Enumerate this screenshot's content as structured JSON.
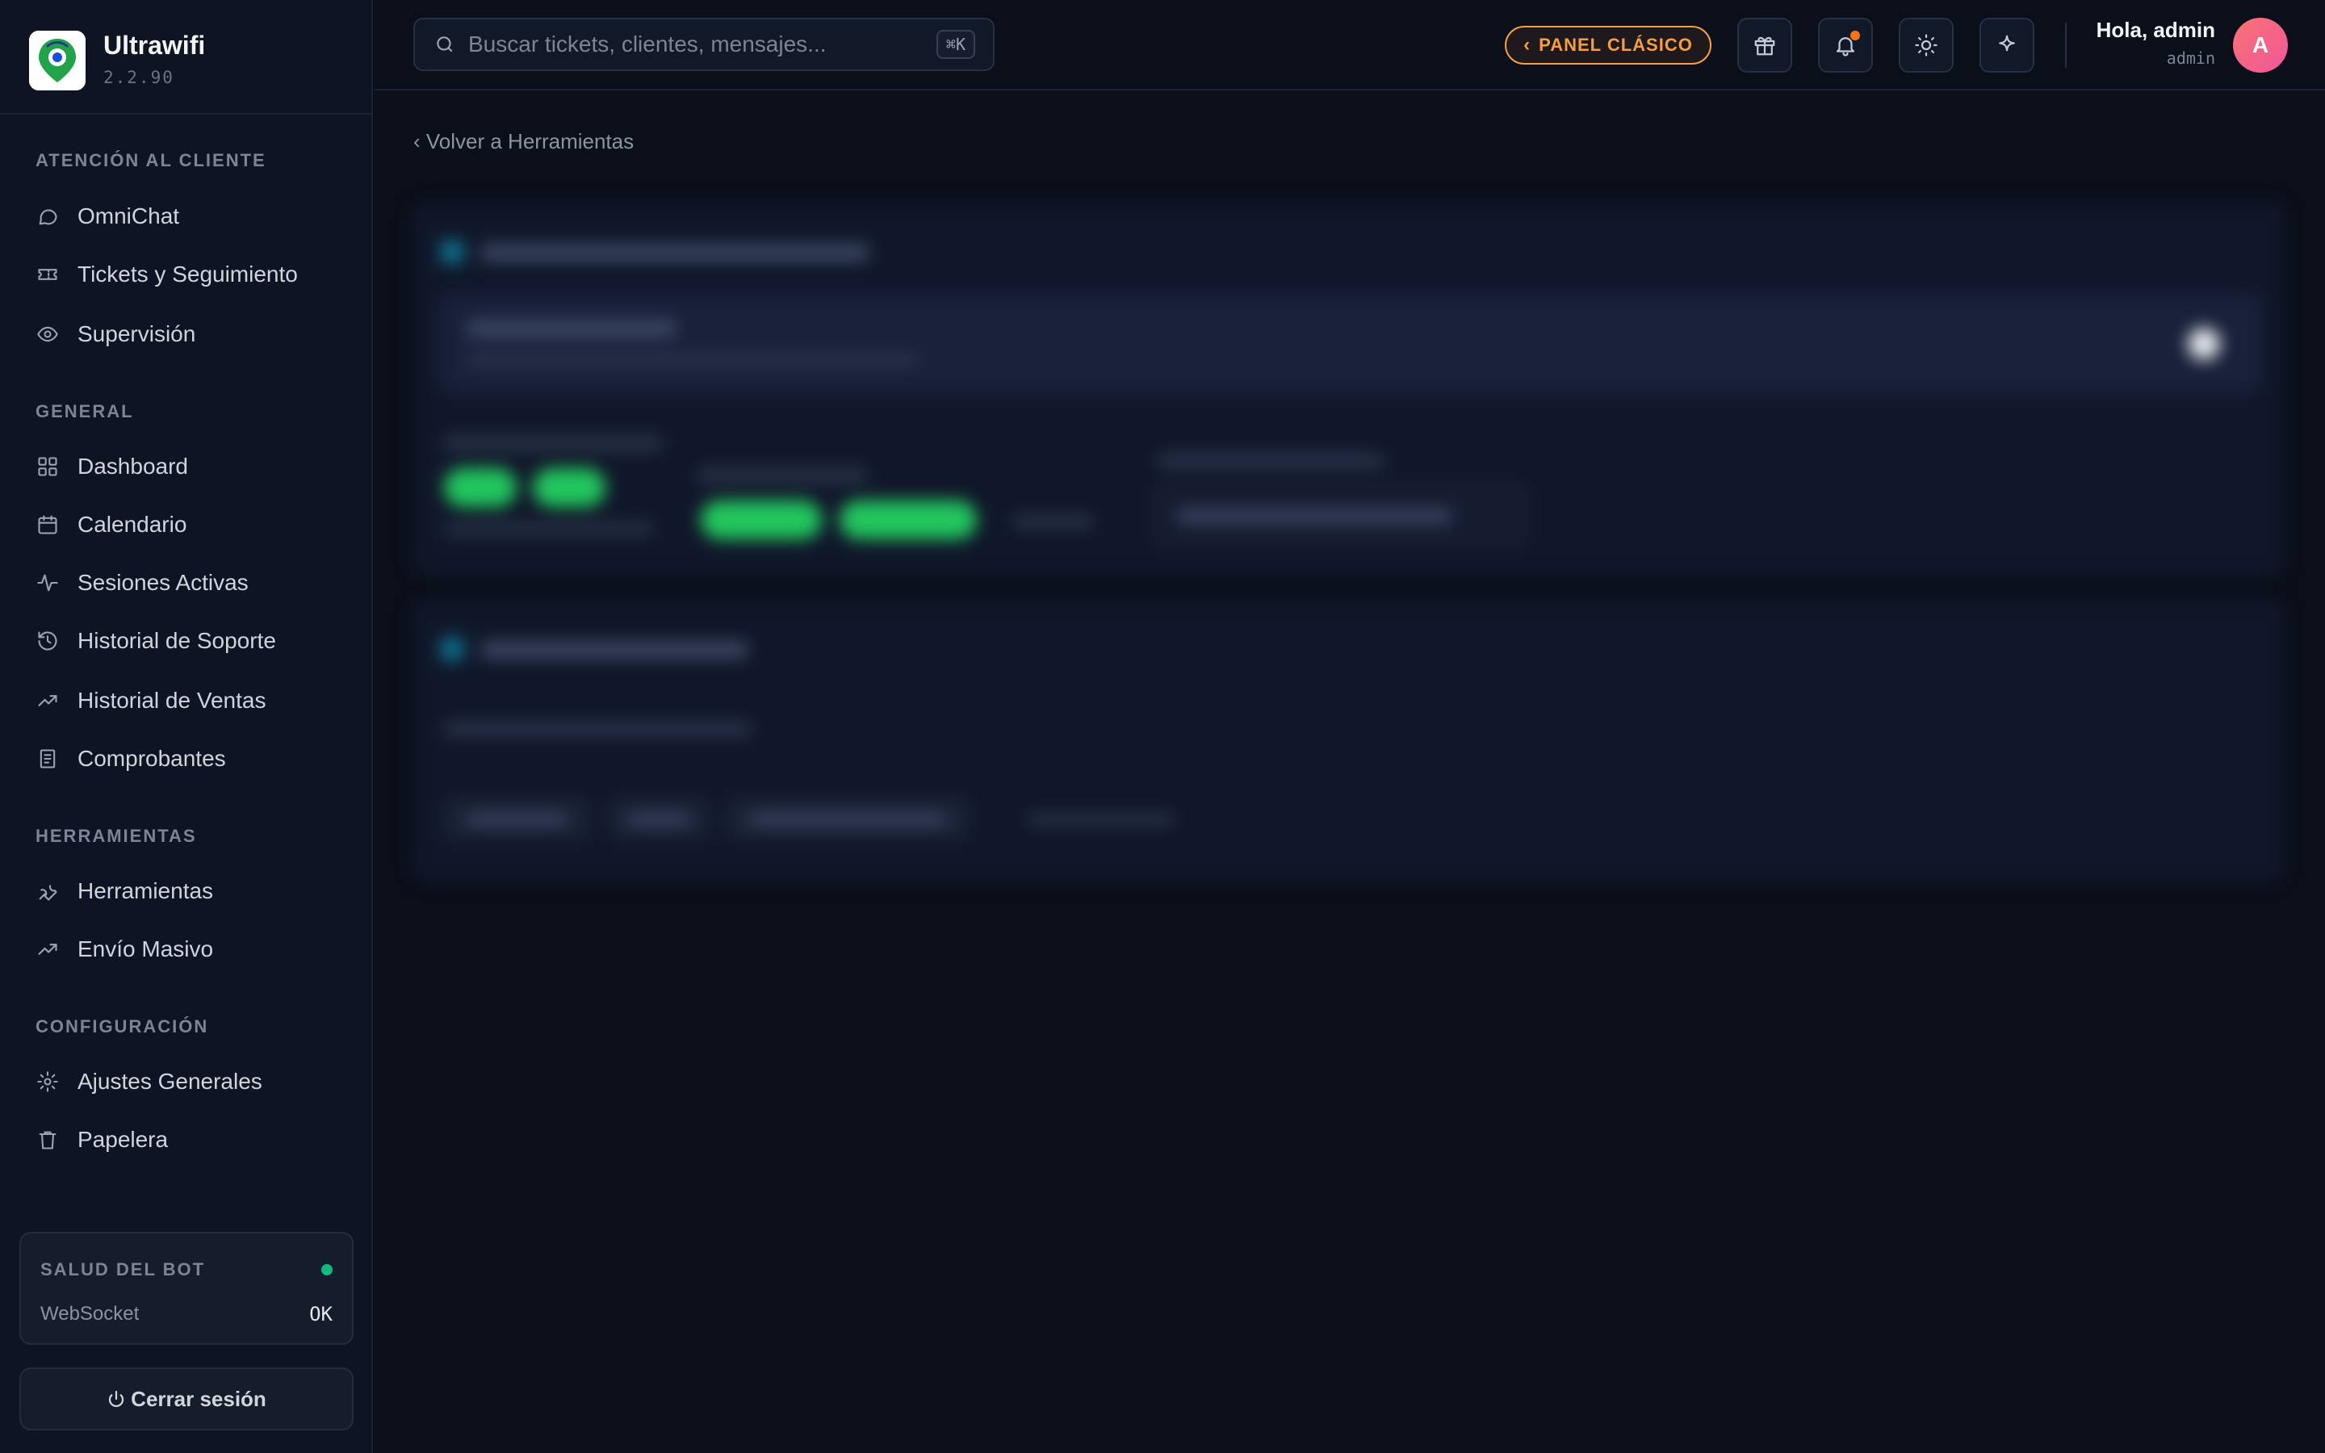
{
  "brand": {
    "name": "Ultrawifi",
    "version": "2.2.90"
  },
  "sidebar": {
    "sections": [
      {
        "label": "ATENCIÓN AL CLIENTE",
        "items": [
          {
            "label": "OmniChat",
            "icon": "chat-bubble-icon"
          },
          {
            "label": "Tickets y Seguimiento",
            "icon": "ticket-icon"
          },
          {
            "label": "Supervisión",
            "icon": "eye-icon"
          }
        ]
      },
      {
        "label": "GENERAL",
        "items": [
          {
            "label": "Dashboard",
            "icon": "grid-icon"
          },
          {
            "label": "Calendario",
            "icon": "calendar-icon"
          },
          {
            "label": "Sesiones Activas",
            "icon": "activity-icon"
          },
          {
            "label": "Historial de Soporte",
            "icon": "history-icon"
          },
          {
            "label": "Historial de Ventas",
            "icon": "trending-up-icon"
          },
          {
            "label": "Comprobantes",
            "icon": "receipt-icon"
          }
        ]
      },
      {
        "label": "HERRAMIENTAS",
        "items": [
          {
            "label": "Herramientas",
            "icon": "wrench-icon"
          },
          {
            "label": "Envío Masivo",
            "icon": "trending-up-icon"
          }
        ]
      },
      {
        "label": "CONFIGURACIÓN",
        "items": [
          {
            "label": "Ajustes Generales",
            "icon": "gear-icon"
          },
          {
            "label": "Papelera",
            "icon": "trash-icon"
          }
        ]
      }
    ],
    "health": {
      "title": "SALUD DEL BOT",
      "key": "WebSocket",
      "value": "OK",
      "status_color": "#10b981"
    },
    "logout_label": "Cerrar sesión"
  },
  "topbar": {
    "search_placeholder": "Buscar tickets, clientes, mensajes...",
    "search_shortcut": "⌘K",
    "classic_panel_label": "PANEL CLÁSICO",
    "greeting": "Hola, admin",
    "role": "admin",
    "avatar_initial": "A"
  },
  "main": {
    "back_link": "‹ Volver a Herramientas"
  },
  "colors": {
    "accent_orange": "#f59e42",
    "toggle_green": "#22c55e",
    "background": "#0b0f1a"
  }
}
